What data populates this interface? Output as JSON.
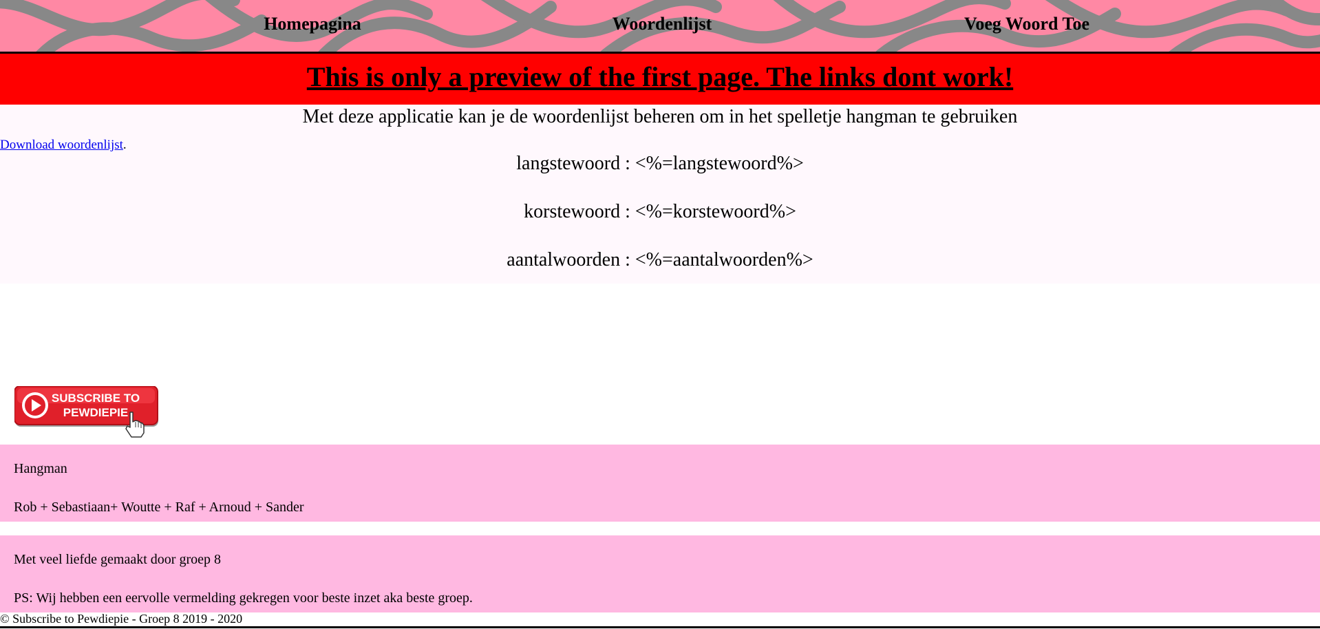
{
  "nav": {
    "items": [
      {
        "label": "Homepagina"
      },
      {
        "label": "Woordenlijst"
      },
      {
        "label": "Voeg Woord Toe"
      }
    ]
  },
  "banner": {
    "text": "This is only a preview of the first page. The links dont work!"
  },
  "main": {
    "intro": "Met deze applicatie kan je de woordenlijst beheren om in het spelletje hangman te gebruiken",
    "download_link": "Download woordenlijst",
    "download_suffix": ".",
    "stats": [
      {
        "text": "langstewoord : <%=langstewoord%>"
      },
      {
        "text": "korstewoord : <%=korstewoord%>"
      },
      {
        "text": "aantalwoorden : <%=aantalwoorden%>"
      }
    ]
  },
  "subscribe_button": {
    "line1": "SUBSCRIBE TO",
    "line2": "PEWDIEPIE"
  },
  "footer": {
    "box1": {
      "title": "Hangman",
      "credits": "Rob + Sebastiaan+ Woutte + Raf + Arnoud + Sander"
    },
    "box2": {
      "line1": "Met veel liefde gemaakt door groep 8",
      "line2": "PS: Wij hebben een eervolle vermelding gekregen voor beste inzet aka beste groep."
    },
    "copyright": "© Subscribe to Pewdiepie - Groep 8 2019 - 2020"
  },
  "colors": {
    "header_bg": "#ff88a4",
    "header_waves": "#888888",
    "banner_bg": "#ff0000",
    "content_bg": "#fff8fd",
    "footer_bg": "#ffb8e1",
    "link": "#0000ee",
    "subscribe_red": "#e0202a"
  },
  "icons": {
    "subscribe_play": "play-icon",
    "subscribe_cursor": "hand-cursor-icon"
  }
}
